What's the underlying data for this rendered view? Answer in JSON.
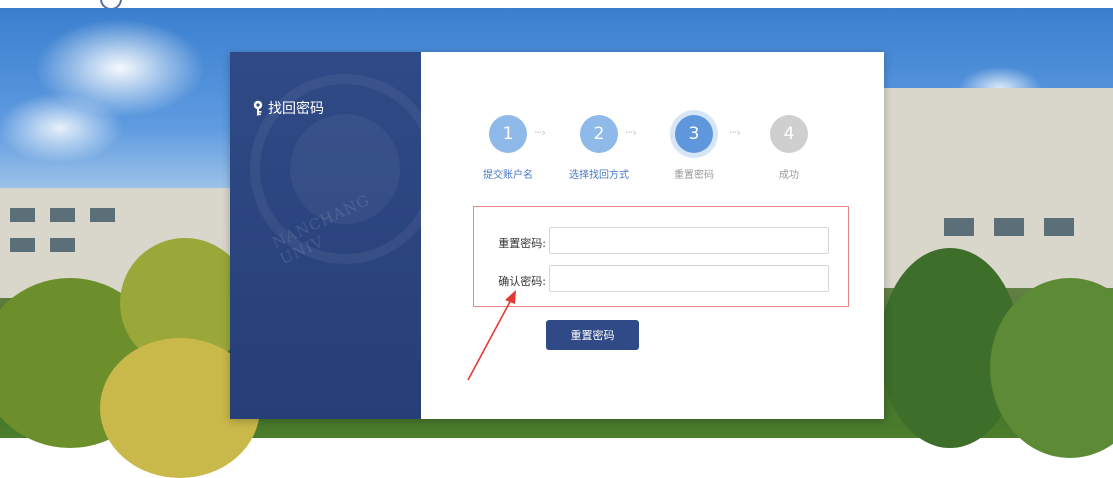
{
  "colors": {
    "brand_blue": "#2f4a86",
    "step_done": "#8fb9e8",
    "step_current": "#5e97db",
    "step_todo": "#cfcfcf",
    "step_label_active": "#4a78c2",
    "step_label_inactive": "#9a9a9a",
    "highlight_border": "#e98a8a",
    "annotation_arrow": "#e53935"
  },
  "panel": {
    "title": "找回密码",
    "icon": "key-icon",
    "seal_text": "NANCHANG UNIV"
  },
  "steps": [
    {
      "number": "1",
      "label": "提交账户名",
      "state": "done"
    },
    {
      "number": "2",
      "label": "选择找回方式",
      "state": "done"
    },
    {
      "number": "3",
      "label": "重置密码",
      "state": "current"
    },
    {
      "number": "4",
      "label": "成功",
      "state": "todo"
    }
  ],
  "form": {
    "new_password_label": "重置密码:",
    "new_password_value": "",
    "confirm_password_label": "确认密码:",
    "confirm_password_value": "",
    "submit_label": "重置密码"
  }
}
